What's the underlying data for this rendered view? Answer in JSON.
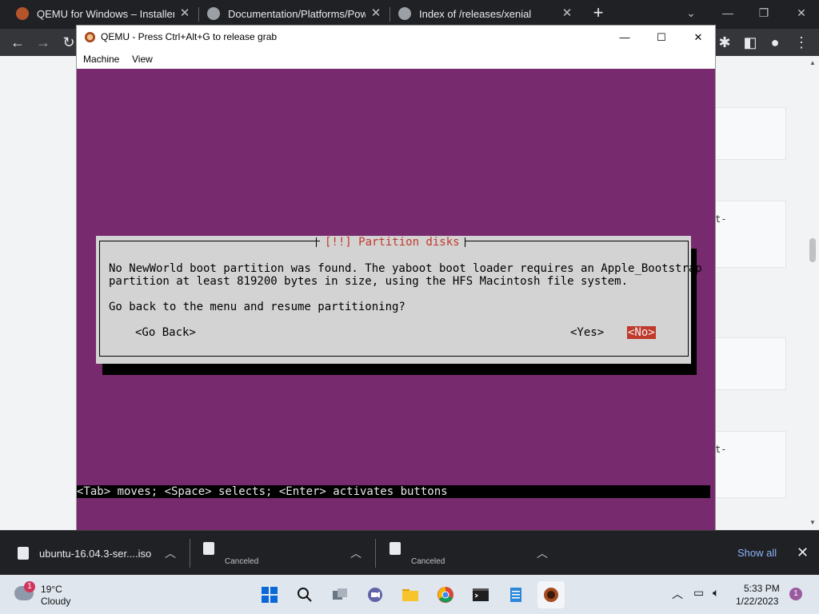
{
  "browser": {
    "tabs": [
      {
        "title": "QEMU for Windows – Installers (",
        "favicon": "qemu-favicon"
      },
      {
        "title": "Documentation/Platforms/Power",
        "favicon": "globe-icon"
      },
      {
        "title": "Index of /releases/xenial",
        "favicon": "globe-icon"
      }
    ],
    "new_tab": "+",
    "page_fragments": [
      "t-",
      "t-"
    ]
  },
  "qemu": {
    "title": "QEMU - Press Ctrl+Alt+G to release grab",
    "menus": [
      "Machine",
      "View"
    ],
    "dialog": {
      "title": "[!!] Partition disks",
      "message_line1": "No NewWorld boot partition was found. The yaboot boot loader requires an Apple_Bootstrap",
      "message_line2": "partition at least 819200 bytes in size, using the HFS Macintosh file system.",
      "question": "Go back to the menu and resume partitioning?",
      "buttons": {
        "go_back": "<Go Back>",
        "yes": "<Yes>",
        "no": "<No>"
      }
    },
    "status_line": "<Tab> moves; <Space> selects; <Enter> activates buttons",
    "colors": {
      "background": "#772a6d",
      "dialog": "#d3d3d3",
      "accent": "#c0392b"
    }
  },
  "downloads": {
    "items": [
      {
        "name": "ubuntu-16.04.3-ser....iso",
        "status": ""
      },
      {
        "name": "",
        "status": "Canceled"
      },
      {
        "name": "",
        "status": "Canceled"
      }
    ],
    "show_all": "Show all"
  },
  "taskbar": {
    "weather": {
      "badge": "1",
      "temp": "19°C",
      "condition": "Cloudy"
    },
    "clock": {
      "time": "5:33 PM",
      "date": "1/22/2023"
    },
    "notification_count": "1"
  }
}
